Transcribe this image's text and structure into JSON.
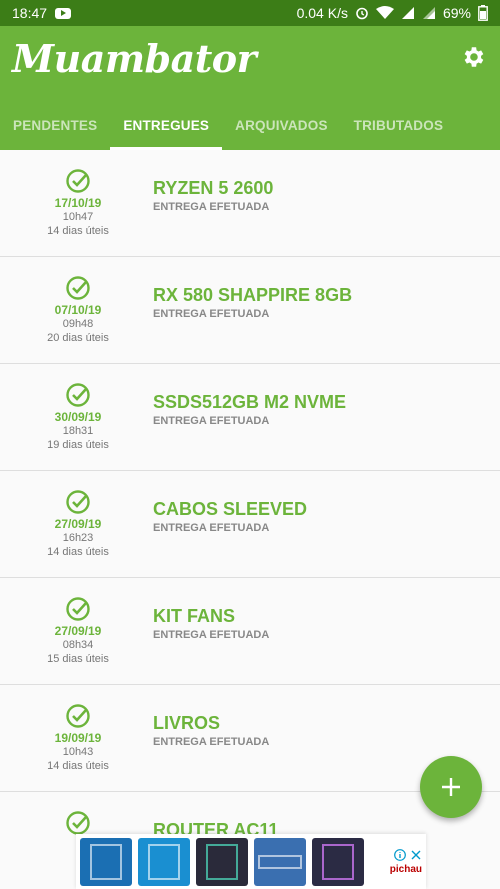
{
  "status_bar": {
    "time": "18:47",
    "speed": "0.04 K/s",
    "battery": "69%"
  },
  "app": {
    "logo": "Muambator",
    "settings_icon": "gear-icon",
    "accent_color": "#6cb43b"
  },
  "tabs": [
    {
      "label": "PENDENTES",
      "active": false
    },
    {
      "label": "ENTREGUES",
      "active": true
    },
    {
      "label": "ARQUIVADOS",
      "active": false
    },
    {
      "label": "TRIBUTADOS",
      "active": false
    }
  ],
  "packages": [
    {
      "date": "17/10/19",
      "time": "10h47",
      "days": "14 dias úteis",
      "title": "RYZEN 5 2600",
      "status": "ENTREGA EFETUADA"
    },
    {
      "date": "07/10/19",
      "time": "09h48",
      "days": "20 dias úteis",
      "title": "RX 580 SHAPPIRE 8GB",
      "status": "ENTREGA EFETUADA"
    },
    {
      "date": "30/09/19",
      "time": "18h31",
      "days": "19 dias úteis",
      "title": "SSDS512GB M2 NVME",
      "status": "ENTREGA EFETUADA"
    },
    {
      "date": "27/09/19",
      "time": "16h23",
      "days": "14 dias úteis",
      "title": "CABOS SLEEVED",
      "status": "ENTREGA EFETUADA"
    },
    {
      "date": "27/09/19",
      "time": "08h34",
      "days": "15 dias úteis",
      "title": "KIT FANS",
      "status": "ENTREGA EFETUADA"
    },
    {
      "date": "19/09/19",
      "time": "10h43",
      "days": "14 dias úteis",
      "title": "LIVROS",
      "status": "ENTREGA EFETUADA"
    },
    {
      "date": "",
      "time": "",
      "days": "",
      "title": "ROUTER AC11",
      "status": ""
    }
  ],
  "fab": {
    "icon": "plus-icon"
  },
  "ad": {
    "products": [
      "#1b6fb3",
      "#1a8fd1",
      "#2a2a3a",
      "#3a6fb0",
      "#2b2b44"
    ],
    "logo": "pichau"
  }
}
